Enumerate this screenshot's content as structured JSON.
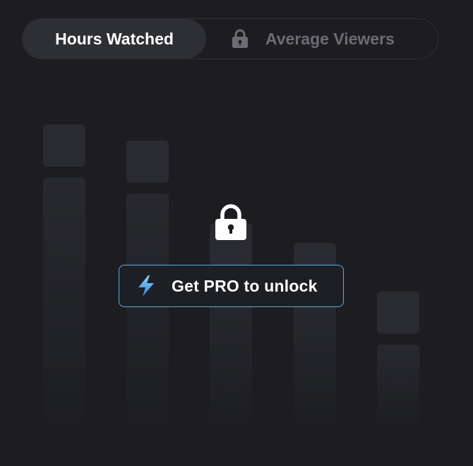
{
  "tabs": {
    "active_label": "Hours Watched",
    "locked_label": "Average Viewers"
  },
  "chart_data": {
    "type": "bar",
    "note_visible": false,
    "categories": [],
    "series": []
  },
  "cta": {
    "label": "Get PRO to unlock",
    "icon": "lightning-bolt-icon",
    "border_color": "#58aee6"
  },
  "lock_icon": "lock-icon",
  "colors": {
    "background": "#1c1c21",
    "active_tab_bg": "#2e2f35",
    "inactive_tab_text": "#6c6d74",
    "accent": "#58aee6"
  }
}
